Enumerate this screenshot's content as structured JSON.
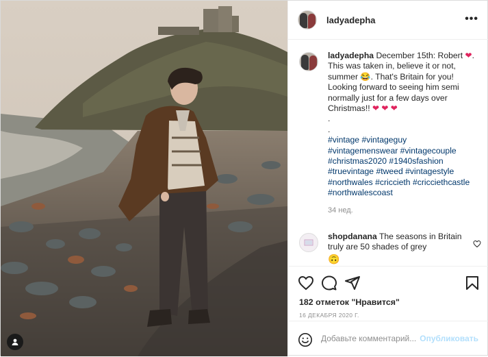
{
  "post": {
    "username": "ladyadepha",
    "more_icon": "more-horizontal-icon",
    "caption": {
      "username": "ladyadepha",
      "line1": "December 15th: Robert",
      "line2": ". This was taken in, believe it or not, summer",
      "line3": ". That's Britain for you! Looking forward to seeing him semi normally just for a few days over Christmas!!",
      "dot1": ".",
      "dot2": ".",
      "tags": [
        "#vintage #vintageguy",
        "#vintagemenswear #vintagecouple",
        "#christmas2020 #1940sfashion",
        "#truevintage #tweed #vintagestyle",
        "#northwales #criccieth #cricciethcastle",
        "#northwalescoast"
      ],
      "ago": "34 нед."
    },
    "comment": {
      "username": "shopdanana",
      "text": "The seasons in Britain truly are 50 shades of grey"
    },
    "likes": "182 отметок \"Нравится\"",
    "date": "16 ДЕКАБРЯ 2020 Г.",
    "add_comment": {
      "placeholder": "Добавьте комментарий...",
      "publish": "Опубликовать"
    },
    "colors": {
      "heart": "#e0245e",
      "link": "#00376b",
      "publish": "#b2dffc"
    }
  }
}
